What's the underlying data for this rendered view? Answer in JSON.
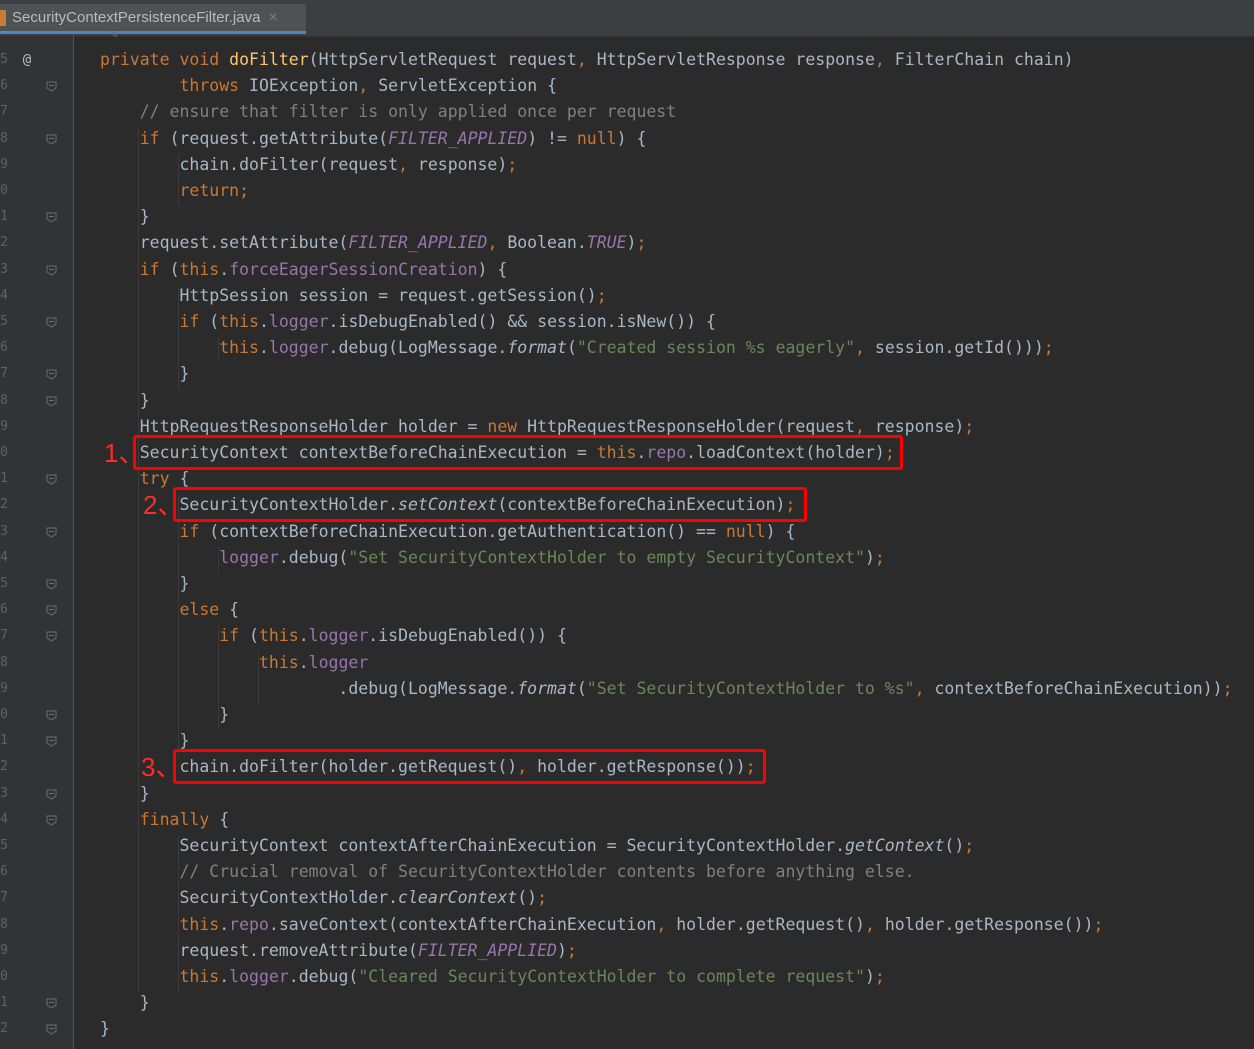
{
  "tab": {
    "filename": "SecurityContextPersistenceFilter.java",
    "close_icon": "×"
  },
  "gutter": {
    "line_numbers": [
      "5",
      "6",
      "7",
      "8",
      "9",
      "0",
      "1",
      "2",
      "3",
      "4",
      "5",
      "6",
      "7",
      "8",
      "9",
      "0",
      "1",
      "2",
      "3",
      "4",
      "5",
      "6",
      "7",
      "8",
      "9",
      "0",
      "1",
      "2",
      "3",
      "4",
      "5",
      "6",
      "7",
      "8",
      "9",
      "0",
      "1",
      "2"
    ],
    "override_marker": "@"
  },
  "code": {
    "lines": [
      [
        [
          "kw",
          "private "
        ],
        [
          "kw",
          "void "
        ],
        [
          "fn",
          "doFilter"
        ],
        [
          "",
          "(HttpServletRequest request"
        ],
        [
          "kw",
          ", "
        ],
        [
          "",
          "HttpServletResponse response"
        ],
        [
          "kw",
          ", "
        ],
        [
          "",
          "FilterChain chain)"
        ]
      ],
      [
        [
          "",
          "        "
        ],
        [
          "kw",
          "throws "
        ],
        [
          "",
          "IOException"
        ],
        [
          "kw",
          ", "
        ],
        [
          "",
          "ServletException {"
        ]
      ],
      [
        [
          "",
          "    "
        ],
        [
          "cm",
          "// ensure that filter is only applied once per request"
        ]
      ],
      [
        [
          "",
          "    "
        ],
        [
          "kw",
          "if "
        ],
        [
          "",
          "(request.getAttribute("
        ],
        [
          "cn",
          "FILTER_APPLIED"
        ],
        [
          "",
          ") != "
        ],
        [
          "kw",
          "null"
        ],
        [
          "",
          ") {"
        ]
      ],
      [
        [
          "",
          "        chain.doFilter(request"
        ],
        [
          "kw",
          ", "
        ],
        [
          "",
          "response)"
        ],
        [
          "kw",
          ";"
        ]
      ],
      [
        [
          "",
          "        "
        ],
        [
          "kw",
          "return;"
        ]
      ],
      [
        [
          "",
          "    }"
        ]
      ],
      [
        [
          "",
          "    request.setAttribute("
        ],
        [
          "cn",
          "FILTER_APPLIED"
        ],
        [
          "kw",
          ", "
        ],
        [
          "",
          "Boolean."
        ],
        [
          "cn",
          "TRUE"
        ],
        [
          "",
          ")"
        ],
        [
          "kw",
          ";"
        ]
      ],
      [
        [
          "",
          "    "
        ],
        [
          "kw",
          "if "
        ],
        [
          "",
          "("
        ],
        [
          "kw",
          "this"
        ],
        [
          "",
          "."
        ],
        [
          "fd",
          "forceEagerSessionCreation"
        ],
        [
          "",
          ") {"
        ]
      ],
      [
        [
          "",
          "        HttpSession session = request.getSession()"
        ],
        [
          "kw",
          ";"
        ]
      ],
      [
        [
          "",
          "        "
        ],
        [
          "kw",
          "if "
        ],
        [
          "",
          "("
        ],
        [
          "kw",
          "this"
        ],
        [
          "",
          "."
        ],
        [
          "fd",
          "logger"
        ],
        [
          "",
          ".isDebugEnabled() && session.isNew()) {"
        ]
      ],
      [
        [
          "",
          "            "
        ],
        [
          "kw",
          "this"
        ],
        [
          "",
          "."
        ],
        [
          "fd",
          "logger"
        ],
        [
          "",
          ".debug(LogMessage."
        ],
        [
          "it",
          "format"
        ],
        [
          "",
          "("
        ],
        [
          "st",
          "\"Created session %s eagerly\""
        ],
        [
          "kw",
          ", "
        ],
        [
          "",
          "session.getId()))"
        ],
        [
          "kw",
          ";"
        ]
      ],
      [
        [
          "",
          "        }"
        ]
      ],
      [
        [
          "",
          "    }"
        ]
      ],
      [
        [
          "",
          "    HttpRequestResponseHolder holder = "
        ],
        [
          "kw",
          "new "
        ],
        [
          "",
          "HttpRequestResponseHolder(request"
        ],
        [
          "kw",
          ", "
        ],
        [
          "",
          "response)"
        ],
        [
          "kw",
          ";"
        ]
      ],
      [
        [
          "",
          "    SecurityContext contextBeforeChainExecution = "
        ],
        [
          "kw",
          "this"
        ],
        [
          "",
          "."
        ],
        [
          "fd",
          "repo"
        ],
        [
          "",
          ".loadContext(holder)"
        ],
        [
          "kw",
          ";"
        ]
      ],
      [
        [
          "",
          "    "
        ],
        [
          "kw",
          "try "
        ],
        [
          "",
          "{"
        ]
      ],
      [
        [
          "",
          "        SecurityContextHolder."
        ],
        [
          "it",
          "setContext"
        ],
        [
          "",
          "(contextBeforeChainExecution)"
        ],
        [
          "kw",
          ";"
        ]
      ],
      [
        [
          "",
          "        "
        ],
        [
          "kw",
          "if "
        ],
        [
          "",
          "(contextBeforeChainExecution.getAuthentication() == "
        ],
        [
          "kw",
          "null"
        ],
        [
          "",
          ") {"
        ]
      ],
      [
        [
          "",
          "            "
        ],
        [
          "fd",
          "logger"
        ],
        [
          "",
          ".debug("
        ],
        [
          "st",
          "\"Set SecurityContextHolder to empty SecurityContext\""
        ],
        [
          "",
          ")"
        ],
        [
          "kw",
          ";"
        ]
      ],
      [
        [
          "",
          "        }"
        ]
      ],
      [
        [
          "",
          "        "
        ],
        [
          "kw",
          "else "
        ],
        [
          "",
          "{"
        ]
      ],
      [
        [
          "",
          "            "
        ],
        [
          "kw",
          "if "
        ],
        [
          "",
          "("
        ],
        [
          "kw",
          "this"
        ],
        [
          "",
          "."
        ],
        [
          "fd",
          "logger"
        ],
        [
          "",
          ".isDebugEnabled()) {"
        ]
      ],
      [
        [
          "",
          "                "
        ],
        [
          "kw",
          "this"
        ],
        [
          "",
          "."
        ],
        [
          "fd",
          "logger"
        ]
      ],
      [
        [
          "",
          "                        .debug(LogMessage."
        ],
        [
          "it",
          "format"
        ],
        [
          "",
          "("
        ],
        [
          "st",
          "\"Set SecurityContextHolder to %s\""
        ],
        [
          "kw",
          ", "
        ],
        [
          "",
          "contextBeforeChainExecution))"
        ],
        [
          "kw",
          ";"
        ]
      ],
      [
        [
          "",
          "            }"
        ]
      ],
      [
        [
          "",
          "        }"
        ]
      ],
      [
        [
          "",
          "        chain.doFilter(holder.getRequest()"
        ],
        [
          "kw",
          ", "
        ],
        [
          "",
          "holder.getResponse())"
        ],
        [
          "kw",
          ";"
        ]
      ],
      [
        [
          "",
          "    }"
        ]
      ],
      [
        [
          "",
          "    "
        ],
        [
          "kw",
          "finally "
        ],
        [
          "",
          "{"
        ]
      ],
      [
        [
          "",
          "        SecurityContext contextAfterChainExecution = SecurityContextHolder."
        ],
        [
          "it",
          "getContext"
        ],
        [
          "",
          "()"
        ],
        [
          "kw",
          ";"
        ]
      ],
      [
        [
          "",
          "        "
        ],
        [
          "cm",
          "// Crucial removal of SecurityContextHolder contents before anything else."
        ]
      ],
      [
        [
          "",
          "        SecurityContextHolder."
        ],
        [
          "it",
          "clearContext"
        ],
        [
          "",
          "()"
        ],
        [
          "kw",
          ";"
        ]
      ],
      [
        [
          "",
          "        "
        ],
        [
          "kw",
          "this"
        ],
        [
          "",
          "."
        ],
        [
          "fd",
          "repo"
        ],
        [
          "",
          ".saveContext(contextAfterChainExecution"
        ],
        [
          "kw",
          ", "
        ],
        [
          "",
          "holder.getRequest()"
        ],
        [
          "kw",
          ", "
        ],
        [
          "",
          "holder.getResponse())"
        ],
        [
          "kw",
          ";"
        ]
      ],
      [
        [
          "",
          "        request.removeAttribute("
        ],
        [
          "cn",
          "FILTER_APPLIED"
        ],
        [
          "",
          ")"
        ],
        [
          "kw",
          ";"
        ]
      ],
      [
        [
          "",
          "        "
        ],
        [
          "kw",
          "this"
        ],
        [
          "",
          "."
        ],
        [
          "fd",
          "logger"
        ],
        [
          "",
          ".debug("
        ],
        [
          "st",
          "\"Cleared SecurityContextHolder to complete request\""
        ],
        [
          "",
          ")"
        ],
        [
          "kw",
          ";"
        ]
      ],
      [
        [
          "",
          "    }"
        ]
      ],
      [
        [
          "",
          "}"
        ]
      ]
    ]
  },
  "annotations": [
    {
      "number": "1、",
      "line": 15
    },
    {
      "number": "2、",
      "line": 17
    },
    {
      "number": "3、",
      "line": 27
    }
  ],
  "colors": {
    "background": "#2b2b2b",
    "keyword": "#cc7832",
    "function": "#ffc66d",
    "comment": "#808080",
    "string": "#6a8759",
    "constant": "#9876aa",
    "highlight_box": "#ff0000"
  }
}
